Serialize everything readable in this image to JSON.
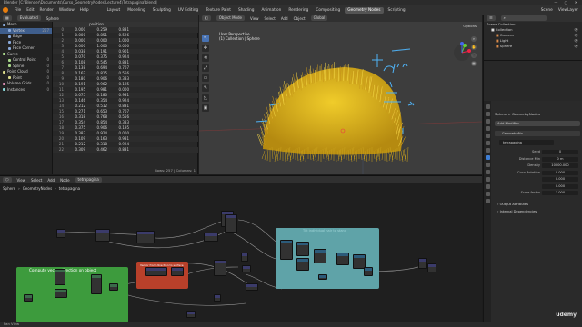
{
  "titlebar": {
    "title": "Blender [C:\\Blender\\Documents\\Curso_GeometryNodes\\Lecture4\\Tetrapagina\\blend]",
    "controls": "— ▢ ✕"
  },
  "menubar": {
    "menus": [
      "File",
      "Edit",
      "Render",
      "Window",
      "Help"
    ],
    "workspaces": [
      "Layout",
      "Modeling",
      "Sculpting",
      "UV Editing",
      "Texture Paint",
      "Shading",
      "Animation",
      "Rendering",
      "Compositing",
      "Geometry Nodes",
      "Scripting"
    ],
    "active_workspace": "Geometry Nodes",
    "scene": "Scene",
    "view_layer": "ViewLayer"
  },
  "spreadsheet": {
    "header_items": [
      "Evaluated",
      "Sphere"
    ],
    "tree": [
      {
        "label": "Mesh",
        "color": "#8aa9d9",
        "indent": 0
      },
      {
        "label": "Vertex",
        "color": "#8aa9d9",
        "indent": 1,
        "count": "257",
        "active": true
      },
      {
        "label": "Edge",
        "color": "#8aa9d9",
        "indent": 1,
        "count": ""
      },
      {
        "label": "Face",
        "color": "#8aa9d9",
        "indent": 1,
        "count": ""
      },
      {
        "label": "Face Corner",
        "color": "#8aa9d9",
        "indent": 1,
        "count": ""
      },
      {
        "label": "Curve",
        "color": "#a9d98a",
        "indent": 0
      },
      {
        "label": "Control Point",
        "color": "#a9d98a",
        "indent": 1,
        "count": "0"
      },
      {
        "label": "Spline",
        "color": "#a9d98a",
        "indent": 1,
        "count": "0"
      },
      {
        "label": "Point Cloud",
        "color": "#d9d98a",
        "indent": 0,
        "count": "0"
      },
      {
        "label": "Point",
        "color": "#d9d98a",
        "indent": 1,
        "count": "0"
      },
      {
        "label": "Volume Grids",
        "color": "#d98ab0",
        "indent": 0,
        "count": "0"
      },
      {
        "label": "Instances",
        "color": "#8ad9d9",
        "indent": 0,
        "count": "0"
      }
    ],
    "column_header": "position",
    "rows": [
      [
        "0",
        "0.000",
        "0.259",
        "0.831"
      ],
      [
        "1",
        "0.000",
        "0.851",
        "0.526"
      ],
      [
        "2",
        "0.000",
        "0.000",
        "1.000"
      ],
      [
        "3",
        "0.000",
        "1.000",
        "0.000"
      ],
      [
        "4",
        "0.038",
        "0.191",
        "0.901"
      ],
      [
        "5",
        "0.070",
        "0.375",
        "0.924"
      ],
      [
        "6",
        "0.108",
        "0.545",
        "0.831"
      ],
      [
        "7",
        "0.138",
        "0.694",
        "0.707"
      ],
      [
        "8",
        "0.162",
        "0.815",
        "0.556"
      ],
      [
        "9",
        "0.180",
        "0.906",
        "0.383"
      ],
      [
        "10",
        "0.191",
        "0.962",
        "0.195"
      ],
      [
        "11",
        "0.195",
        "0.981",
        "0.000"
      ],
      [
        "12",
        "0.075",
        "0.180",
        "0.981"
      ],
      [
        "13",
        "0.146",
        "0.354",
        "0.924"
      ],
      [
        "14",
        "0.212",
        "0.512",
        "0.831"
      ],
      [
        "15",
        "0.271",
        "0.653",
        "0.707"
      ],
      [
        "16",
        "0.318",
        "0.768",
        "0.556"
      ],
      [
        "17",
        "0.354",
        "0.854",
        "0.383"
      ],
      [
        "18",
        "0.375",
        "0.906",
        "0.195"
      ],
      [
        "19",
        "0.383",
        "0.924",
        "0.000"
      ],
      [
        "20",
        "0.109",
        "0.163",
        "0.981"
      ],
      [
        "21",
        "0.212",
        "0.318",
        "0.924"
      ],
      [
        "22",
        "0.309",
        "0.462",
        "0.831"
      ]
    ],
    "footer": "Rows: 257 | Columns: 1"
  },
  "viewport": {
    "header_items": [
      "Object Mode",
      "View",
      "Select",
      "Add",
      "Object"
    ],
    "orientation": "Global",
    "options": "Options",
    "info_line1": "User Perspective",
    "info_line2": "(1) Collection | Sphere",
    "tools": [
      "↖",
      "✥",
      "⟲",
      "⤢",
      "▭",
      "✎",
      "◺",
      "▣"
    ],
    "nav": [
      "⌕",
      "✋",
      "🎥",
      "▦"
    ],
    "hair_color": "#e3bb1f",
    "annotation_color": "#4fb2f5"
  },
  "outliner": {
    "title": "Scene Collection",
    "items": [
      {
        "label": "Collection",
        "color": "#ddd",
        "indent": 1
      },
      {
        "label": "Camera",
        "color": "#d98a4a",
        "indent": 2
      },
      {
        "label": "Light",
        "color": "#d98a4a",
        "indent": 2
      },
      {
        "label": "Sphere",
        "color": "#d98a4a",
        "indent": 2
      }
    ]
  },
  "properties": {
    "breadcrumb": "Sphere  >  GeometryNodes",
    "add_modifier": "Add Modifier",
    "modifier_name": "GeometryNo...",
    "node_group": "tetrapagina",
    "fields": [
      {
        "label": "Seed",
        "value": "0"
      },
      {
        "label": "Distance Min",
        "value": "0 m"
      },
      {
        "label": "Density",
        "value": "10000.000"
      },
      {
        "label": "Coco Rotation",
        "value": "0.000"
      },
      {
        "label": "",
        "value": "0.000"
      },
      {
        "label": "",
        "value": "0.000"
      },
      {
        "label": "Scale factor",
        "value": "1.000"
      }
    ],
    "sections": [
      "Output Attributes",
      "Internal Dependencies"
    ]
  },
  "node_editor": {
    "header_items": [
      "View",
      "Select",
      "Add",
      "Node"
    ],
    "tree_name": "tetrapagina",
    "breadcrumb": [
      "Sphere",
      "GeometryNodes",
      "tetrapagina"
    ],
    "frames": [
      {
        "label": "Compute vector direction on object",
        "color": "#3d9b3d"
      },
      {
        "label": "Vector from direction to surface",
        "color": "#b8402a"
      },
      {
        "label": "Tilt individual hair to stand",
        "color": "#5fa3a8"
      }
    ]
  },
  "status": {
    "text": "Pan View"
  },
  "watermark": "udemy"
}
